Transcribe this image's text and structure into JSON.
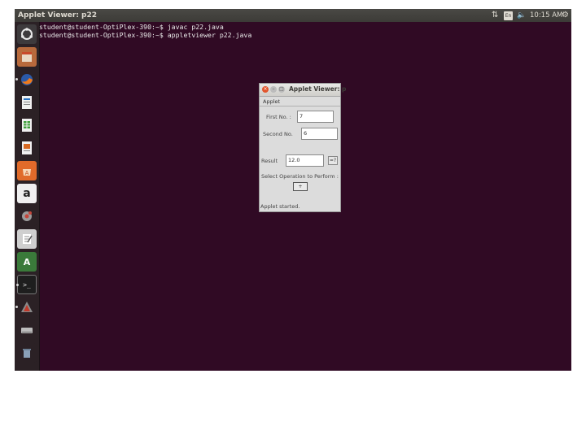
{
  "top_panel": {
    "window_title": "Applet Viewer: p22",
    "keyboard_layout": "En",
    "clock": "10:15 AM",
    "network_icon": "network-arrows-icon",
    "volume_icon": "speaker-icon",
    "power_icon": "gear-icon"
  },
  "launcher": {
    "items": [
      {
        "name": "ubuntu-dash-icon"
      },
      {
        "name": "files-icon"
      },
      {
        "name": "firefox-icon"
      },
      {
        "name": "libreoffice-writer-icon"
      },
      {
        "name": "libreoffice-calc-icon"
      },
      {
        "name": "libreoffice-impress-icon"
      },
      {
        "name": "ubuntu-software-center-icon"
      },
      {
        "name": "amazon-icon",
        "label": "a"
      },
      {
        "name": "system-settings-icon"
      },
      {
        "name": "text-editor-icon"
      },
      {
        "name": "software-updater-icon",
        "label": "A"
      },
      {
        "name": "terminal-icon",
        "label": ">_"
      },
      {
        "name": "java-app-icon"
      },
      {
        "name": "drive-icon"
      },
      {
        "name": "trash-icon"
      }
    ]
  },
  "terminal": {
    "lines": [
      "student@student-OptiPlex-390:~$ javac p22.java",
      "student@student-OptiPlex-390:~$ appletviewer p22.java"
    ]
  },
  "applet": {
    "title": "Applet Viewer: p",
    "menu_label": "Applet",
    "first_no_label": "First No.  :",
    "first_no_value": "7",
    "second_no_label": "Second No.",
    "second_no_value": "6",
    "result_label": "Result",
    "result_value": "12.0",
    "calc_button_label": "=?",
    "operator_label": "Select Operation to Perform :",
    "operator_value": "+",
    "status": "Applet started."
  },
  "colors": {
    "desktop_bg": "#300a24",
    "panel_bg": "#3c3b37",
    "close_button": "#e2542c"
  }
}
